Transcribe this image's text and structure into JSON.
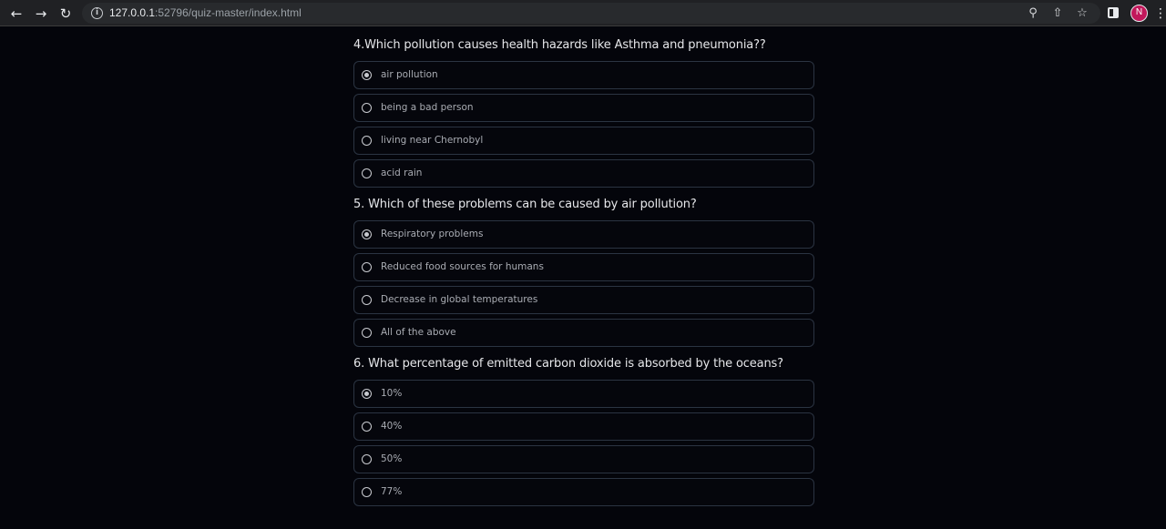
{
  "browser": {
    "url_host": "127.0.0.1",
    "url_rest": ":52796/quiz-master/index.html",
    "profile_initial": "N",
    "icons": {
      "back": "arrow-left-icon",
      "forward": "arrow-right-icon",
      "reload": "reload-icon",
      "info": "info-icon",
      "zoom": "zoom-icon",
      "share": "share-icon",
      "bookmark": "star-icon",
      "side_panel": "side-panel-icon"
    }
  },
  "quiz": {
    "questions": [
      {
        "text": "4.Which pollution causes health hazards like Asthma and pneumonia??",
        "options": [
          "air pollution",
          "being a bad person",
          "living near Chernobyl",
          "acid rain"
        ],
        "selected": 0
      },
      {
        "text": "5. Which of these problems can be caused by air pollution?",
        "options": [
          "Respiratory problems",
          "Reduced food sources for humans",
          "Decrease in global temperatures",
          "All of the above"
        ],
        "selected": 0
      },
      {
        "text": "6. What percentage of emitted carbon dioxide is absorbed by the oceans?",
        "options": [
          "10%",
          "40%",
          "50%",
          "77%"
        ],
        "selected": 0
      }
    ]
  },
  "colors": {
    "page_background": "#04050b",
    "option_border": "#2b3442",
    "question_text": "#e6e7ea",
    "option_text": "#a9acb3",
    "avatar": "#c2185b"
  }
}
